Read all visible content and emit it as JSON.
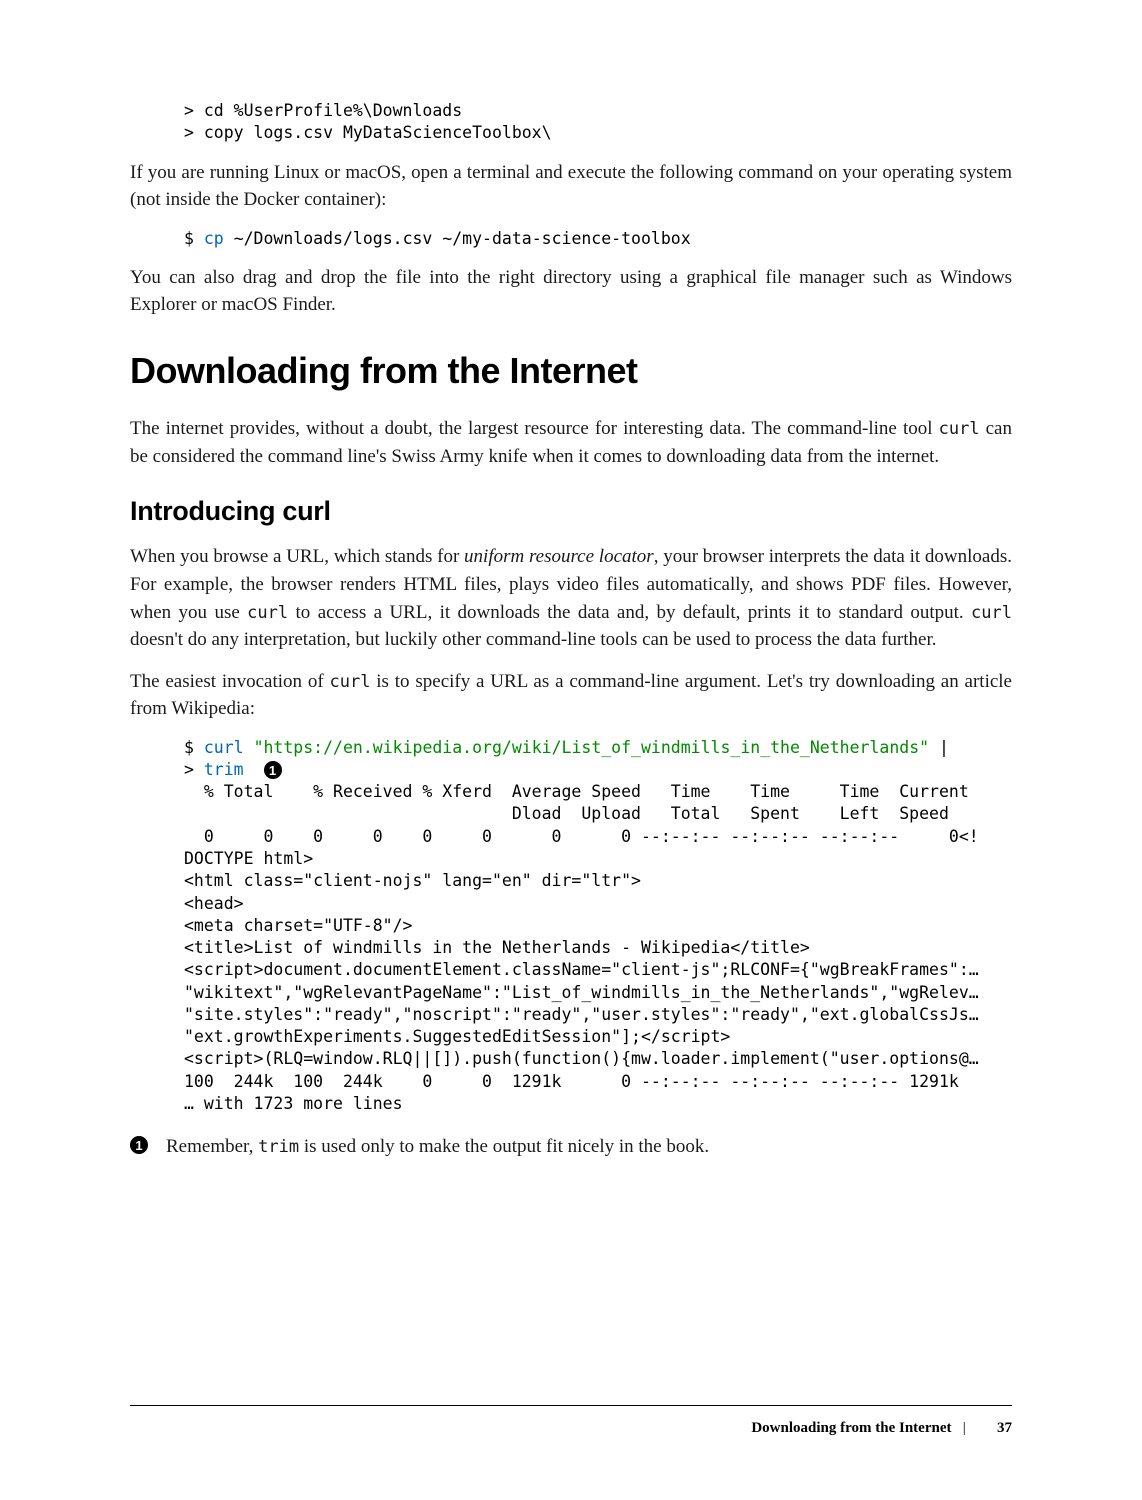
{
  "codeblock1": {
    "line1": "> cd %UserProfile%\\Downloads",
    "line2": "> copy logs.csv MyDataScienceToolbox\\"
  },
  "para1": "If you are running Linux or macOS, open a terminal and execute the following com­mand on your operating system (not inside the Docker container):",
  "codeblock2": {
    "prompt": "$",
    "cmd": "cp",
    "args": "~/Downloads/logs.csv ~/my-data-science-toolbox"
  },
  "para2": "You can also drag and drop the file into the right directory using a graphical file man­ager such as Windows Explorer or macOS Finder.",
  "h1": "Downloading from the Internet",
  "para3_a": "The internet provides, without a doubt, the largest resource for interesting data. The command-line tool ",
  "para3_cmd": "curl",
  "para3_b": " can be considered the command line's Swiss Army knife when it comes to downloading data from the internet.",
  "h2": "Introducing curl",
  "para4_a": "When you browse a URL, which stands for ",
  "para4_em": "uniform resource locator",
  "para4_b": ", your browser interprets the data it downloads. For example, the browser renders HTML files, plays video files automatically, and shows PDF files. However, when you use ",
  "para4_cmd1": "curl",
  "para4_c": " to access a URL, it downloads the data and, by default, prints it to standard output. ",
  "para4_cmd2": "curl",
  "para4_d": " doesn't do any interpretation, but luckily other command-line tools can be used to process the data further.",
  "para5_a": "The easiest invocation of ",
  "para5_cmd": "curl",
  "para5_b": " is to specify a URL as a command-line argument. Let's try downloading an article from Wikipedia:",
  "codeblock3": {
    "l1_prompt": "$",
    "l1_cmd": "curl",
    "l1_str": "\"https://en.wikipedia.org/wiki/List_of_windmills_in_the_Netherlands\"",
    "l1_pipe": " |",
    "l2_prompt": ">",
    "l2_cmd": "trim",
    "callout": "1",
    "out1": "  % Total    % Received % Xferd  Average Speed   Time    Time     Time  Current",
    "out2": "                                 Dload  Upload   Total   Spent    Left  Speed",
    "out3": "  0     0    0     0    0     0      0      0 --:--:-- --:--:-- --:--:--     0<!",
    "out4": "DOCTYPE html>",
    "out5": "<html class=\"client-nojs\" lang=\"en\" dir=\"ltr\">",
    "out6": "<head>",
    "out7": "<meta charset=\"UTF-8\"/>",
    "out8": "<title>List of windmills in the Netherlands - Wikipedia</title>",
    "out9": "<script>document.documentElement.className=\"client-js\";RLCONF={\"wgBreakFrames\":…",
    "out10": "\"wikitext\",\"wgRelevantPageName\":\"List_of_windmills_in_the_Netherlands\",\"wgRelev…",
    "out11": "\"site.styles\":\"ready\",\"noscript\":\"ready\",\"user.styles\":\"ready\",\"ext.globalCssJs…",
    "out12": "\"ext.growthExperiments.SuggestedEditSession\"];</script>",
    "out13": "<script>(RLQ=window.RLQ||[]).push(function(){mw.loader.implement(\"user.options@…",
    "out14": "100  244k  100  244k    0     0  1291k      0 --:--:-- --:--:-- --:--:-- 1291k",
    "out15": "… with 1723 more lines"
  },
  "callout1_num": "1",
  "callout1_a": "Remember, ",
  "callout1_cmd": "trim",
  "callout1_b": " is used only to make the output fit nicely in the book.",
  "footer": {
    "title": "Downloading from the Internet",
    "sep": "|",
    "page": "37"
  }
}
